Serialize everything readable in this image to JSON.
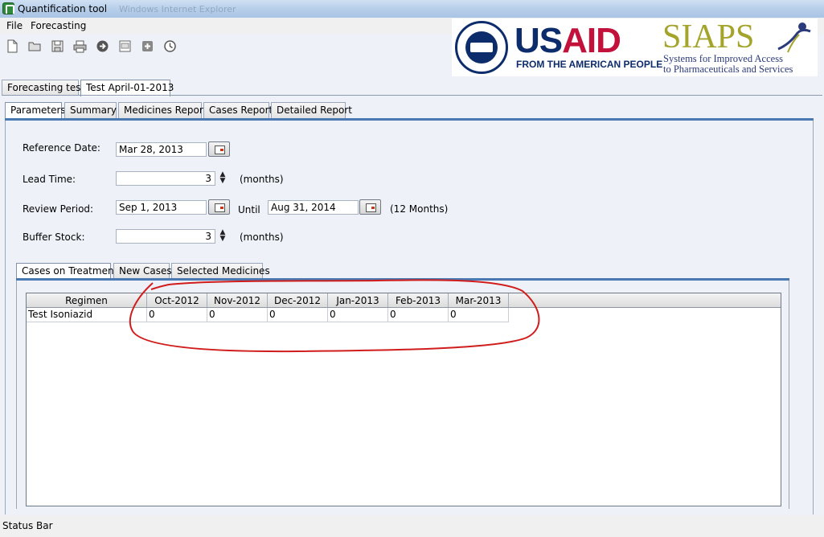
{
  "window": {
    "title": "Quantification tool",
    "ghost_title": "Windows Internet Explorer"
  },
  "menu": [
    "File",
    "Forecasting"
  ],
  "toolbar_icons": [
    "new-file-icon",
    "open-folder-icon",
    "save-icon",
    "print-icon",
    "go-arrow-icon",
    "export-icon",
    "add-icon",
    "clock-icon"
  ],
  "logos": {
    "usaid_seal_text": "USAID",
    "usaid_us": "US",
    "usaid_aid": "AID",
    "usaid_tagline": "FROM THE AMERICAN PEOPLE",
    "siaps_word": "SIAPS",
    "siaps_line1": "Systems for Improved Access",
    "siaps_line2": "to Pharmaceuticals and Services"
  },
  "outer_tabs": [
    "Forecasting test",
    "Test April-01-2013"
  ],
  "inner_tabs": [
    "Parameters",
    "Summary",
    "Medicines Report",
    "Cases Report",
    "Detailed Report"
  ],
  "form": {
    "reference_date_label": "Reference Date:",
    "reference_date": "Mar 28, 2013",
    "lead_time_label": "Lead Time:",
    "lead_time": "3",
    "months_unit": "(months)",
    "review_period_label": "Review Period:",
    "review_start": "Sep 1, 2013",
    "until_label": "Until",
    "review_end": "Aug 31, 2014",
    "review_months": "(12 Months)",
    "buffer_stock_label": "Buffer Stock:",
    "buffer_stock": "3",
    "buffer_unit": "(months)"
  },
  "sub_tabs": [
    "Cases on Treatment",
    "New Cases",
    "Selected Medicines"
  ],
  "table": {
    "headers": [
      "Regimen",
      "Oct-2012",
      "Nov-2012",
      "Dec-2012",
      "Jan-2013",
      "Feb-2013",
      "Mar-2013"
    ],
    "rows": [
      [
        "Test Isoniazid",
        "0",
        "0",
        "0",
        "0",
        "0",
        "0"
      ]
    ]
  },
  "status_bar": "Status Bar",
  "colors": {
    "tab_underline": "#4a78b0",
    "annotation": "#d11c1c",
    "usaid_blue": "#0d2c6c",
    "usaid_red": "#c2113a",
    "siaps_olive": "#a4a32a"
  }
}
